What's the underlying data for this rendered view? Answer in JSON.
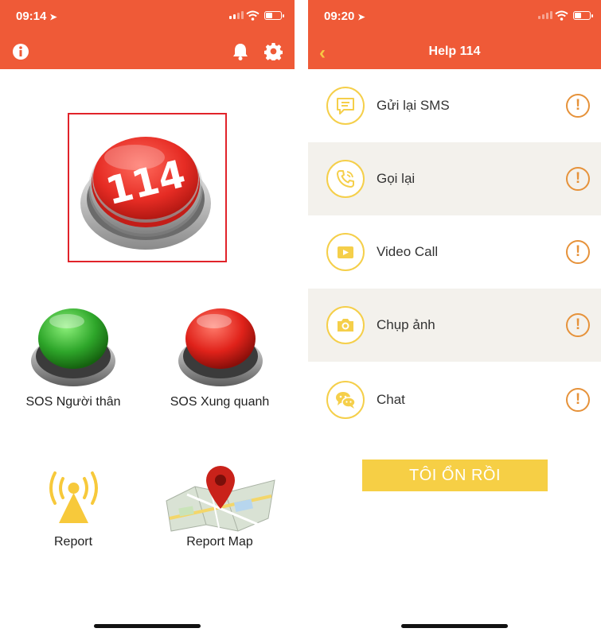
{
  "left_screen": {
    "status_time": "09:14",
    "main_button_number": "114",
    "buttons": [
      {
        "label": "SOS Người thân",
        "icon": "green-round-button"
      },
      {
        "label": "SOS Xung quanh",
        "icon": "red-round-button"
      },
      {
        "label": "Report",
        "icon": "broadcast-signal-icon"
      },
      {
        "label": "Report Map",
        "icon": "map-pin-icon"
      }
    ]
  },
  "right_screen": {
    "status_time": "09:20",
    "title": "Help 114",
    "items": [
      {
        "label": "Gửi lại SMS",
        "icon": "sms-icon"
      },
      {
        "label": "Gọi lại",
        "icon": "phone-call-icon"
      },
      {
        "label": "Video Call",
        "icon": "video-call-icon"
      },
      {
        "label": "Chụp ảnh",
        "icon": "camera-icon"
      },
      {
        "label": "Chat",
        "icon": "chat-icon"
      }
    ],
    "ok_button": "TÔI ỔN RỒI"
  },
  "colors": {
    "header": "#ef5a37",
    "accent_yellow": "#f6cf45",
    "warning_orange": "#e6923a",
    "frame_red": "#e1232a"
  }
}
